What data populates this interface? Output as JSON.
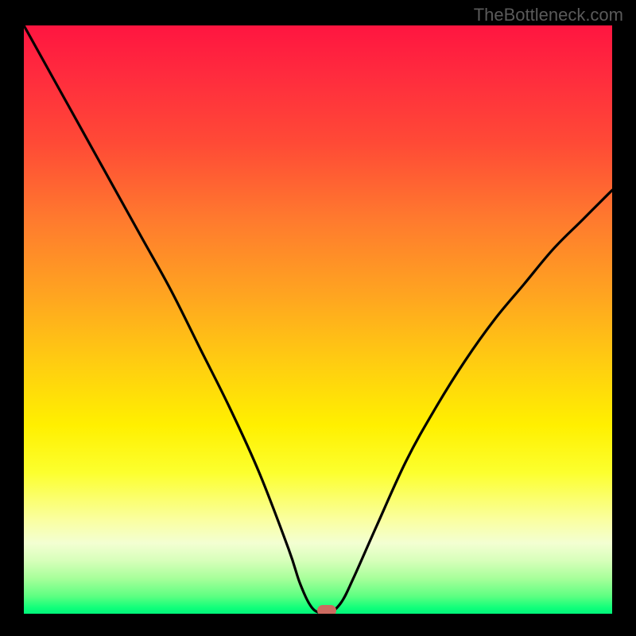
{
  "watermark": "TheBottleneck.com",
  "colors": {
    "frame": "#000000",
    "curve": "#000000",
    "marker": "#cc6a60",
    "gradient_top": "#ff1540",
    "gradient_bottom": "#00f47a"
  },
  "chart_data": {
    "type": "line",
    "title": "",
    "xlabel": "",
    "ylabel": "",
    "xlim": [
      0,
      100
    ],
    "ylim": [
      0,
      100
    ],
    "grid": false,
    "legend": false,
    "series": [
      {
        "name": "bottleneck-curve",
        "x": [
          0,
          5,
          10,
          15,
          20,
          25,
          30,
          35,
          40,
          45,
          47,
          49,
          51,
          52,
          54,
          56,
          60,
          65,
          70,
          75,
          80,
          85,
          90,
          95,
          100
        ],
        "values": [
          100,
          91,
          82,
          73,
          64,
          55,
          45,
          35,
          24,
          11,
          5,
          1,
          0,
          0,
          2,
          6,
          15,
          26,
          35,
          43,
          50,
          56,
          62,
          67,
          72
        ]
      }
    ],
    "annotations": [
      {
        "name": "optimal-marker",
        "x": 51.5,
        "y": 0.5,
        "shape": "pill",
        "color": "#cc6a60"
      }
    ],
    "background_gradient": {
      "direction": "vertical",
      "stops": [
        {
          "pos": 0.0,
          "color": "#ff1540"
        },
        {
          "pos": 0.33,
          "color": "#ff7a2e"
        },
        {
          "pos": 0.68,
          "color": "#fff000"
        },
        {
          "pos": 0.88,
          "color": "#f3ffd2"
        },
        {
          "pos": 1.0,
          "color": "#00f47a"
        }
      ]
    }
  }
}
